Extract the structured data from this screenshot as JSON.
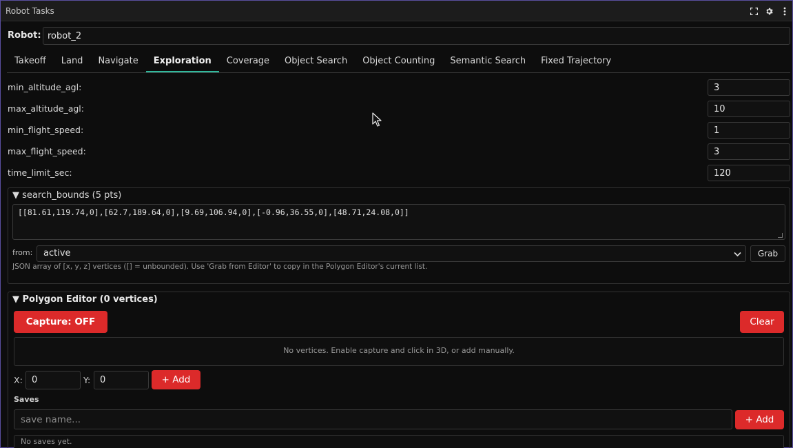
{
  "window": {
    "title": "Robot Tasks"
  },
  "robot": {
    "label": "Robot:",
    "value": "robot_2"
  },
  "tabs": [
    {
      "label": "Takeoff"
    },
    {
      "label": "Land"
    },
    {
      "label": "Navigate"
    },
    {
      "label": "Exploration",
      "active": true
    },
    {
      "label": "Coverage"
    },
    {
      "label": "Object Search"
    },
    {
      "label": "Object Counting"
    },
    {
      "label": "Semantic Search"
    },
    {
      "label": "Fixed Trajectory"
    }
  ],
  "params": {
    "min_altitude_agl": {
      "label": "min_altitude_agl:",
      "value": "3"
    },
    "max_altitude_agl": {
      "label": "max_altitude_agl:",
      "value": "10"
    },
    "min_flight_speed": {
      "label": "min_flight_speed:",
      "value": "1"
    },
    "max_flight_speed": {
      "label": "max_flight_speed:",
      "value": "3"
    },
    "time_limit_sec": {
      "label": "time_limit_sec:",
      "value": "120"
    }
  },
  "search_bounds": {
    "header": "▼ search_bounds (5 pts)",
    "json": "[[81.61,119.74,0],[62.7,189.64,0],[9.69,106.94,0],[-0.96,36.55,0],[48.71,24.08,0]]",
    "from_label": "from:",
    "from_value": "active",
    "grab_label": "Grab",
    "hint": "JSON array of [x, y, z] vertices ([] = unbounded). Use 'Grab from Editor' to copy in the Polygon Editor's current list."
  },
  "polygon_editor": {
    "header": "▼ Polygon Editor (0 vertices)",
    "capture_label": "Capture: OFF",
    "clear_label": "Clear",
    "empty_text": "No vertices. Enable capture and click in 3D, or add manually.",
    "x_label": "X:",
    "x_value": "0",
    "y_label": "Y:",
    "y_value": "0",
    "add_label": "+ Add"
  },
  "saves": {
    "title": "Saves",
    "placeholder": "save name...",
    "add_label": "+ Add",
    "empty_text": "No saves yet."
  },
  "colors": {
    "accent": "#30b89c",
    "danger": "#dc2a2a",
    "border": "#5a4fa0"
  },
  "icons": {
    "fullscreen": "fullscreen-icon",
    "settings": "gear-icon",
    "menu": "kebab-menu-icon",
    "dropdown": "chevron-down-icon"
  }
}
